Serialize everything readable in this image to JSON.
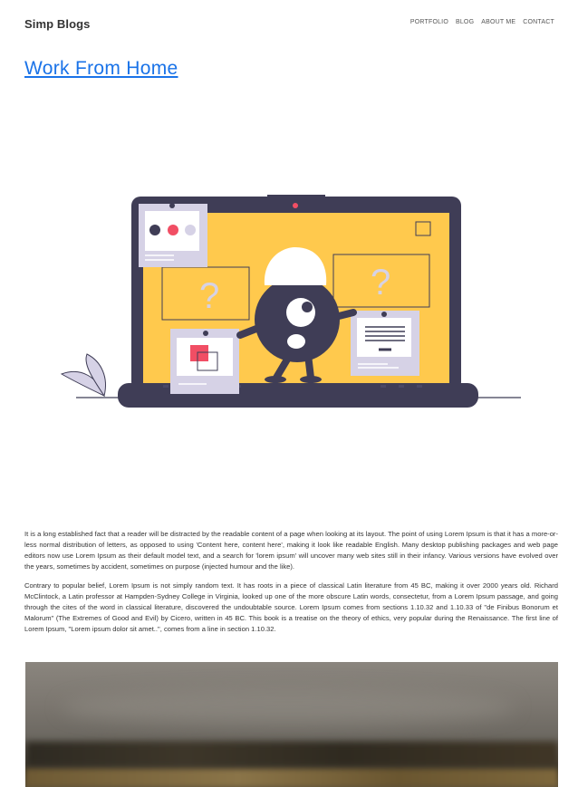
{
  "site": {
    "brand": "Simp Blogs"
  },
  "nav": {
    "items": [
      "PORTFOLIO",
      "BLOG",
      "ABOUT ME",
      "CONTACT"
    ]
  },
  "post": {
    "title": "Work From Home",
    "paragraphs": [
      "It is a long established fact that a reader will be distracted by the readable content of a page when looking at its layout. The point of using Lorem Ipsum is that it has a more-or-less normal distribution of letters, as opposed to using 'Content here, content here', making it look like readable English. Many desktop publishing packages and web page editors now use Lorem Ipsum as their default model text, and a search for 'lorem ipsum' will uncover many web sites still in their infancy. Various versions have evolved over the years, sometimes by accident, sometimes on purpose (injected humour and the like).",
      "Contrary to popular belief, Lorem Ipsum is not simply random text. It has roots in a piece of classical Latin literature from 45 BC, making it over 2000 years old. Richard McClintock, a Latin professor at Hampden-Sydney College in Virginia, looked up one of the more obscure Latin words, consectetur, from a Lorem Ipsum passage, and going through the cites of the word in classical literature, discovered the undoubtable source. Lorem Ipsum comes from sections 1.10.32 and 1.10.33 of \"de Finibus Bonorum et Malorum\" (The Extremes of Good and Evil) by Cicero, written in 45 BC. This book is a treatise on the theory of ethics, very popular during the Renaissance. The first line of Lorem Ipsum, \"Lorem ipsum dolor sit amet..\", comes from a line in section 1.10.32."
    ]
  },
  "hero": {
    "question_marks": [
      "?",
      "?"
    ],
    "colors": {
      "screen": "#ffc94d",
      "laptop": "#3f3d56",
      "accent": "#f14e64",
      "card": "#d6d2e6",
      "white": "#ffffff"
    }
  },
  "colors": {
    "link": "#1a73e8",
    "text": "#333333"
  }
}
